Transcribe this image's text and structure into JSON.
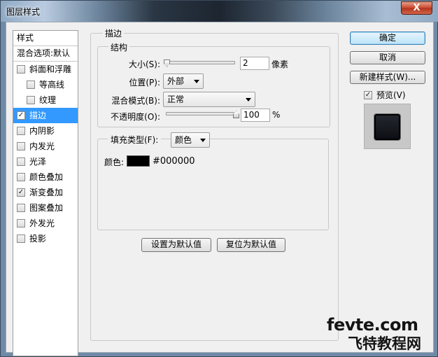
{
  "window": {
    "title": "图层样式",
    "close_label": "X"
  },
  "styles_list": {
    "header": "样式",
    "blending_options": "混合选项:默认",
    "items": [
      {
        "label": "斜面和浮雕",
        "checked": false,
        "indent": false,
        "selected": false
      },
      {
        "label": "等高线",
        "checked": false,
        "indent": true,
        "selected": false
      },
      {
        "label": "纹理",
        "checked": false,
        "indent": true,
        "selected": false
      },
      {
        "label": "描边",
        "checked": true,
        "indent": false,
        "selected": true
      },
      {
        "label": "内阴影",
        "checked": false,
        "indent": false,
        "selected": false
      },
      {
        "label": "内发光",
        "checked": false,
        "indent": false,
        "selected": false
      },
      {
        "label": "光泽",
        "checked": false,
        "indent": false,
        "selected": false
      },
      {
        "label": "颜色叠加",
        "checked": false,
        "indent": false,
        "selected": false
      },
      {
        "label": "渐变叠加",
        "checked": true,
        "indent": false,
        "selected": false
      },
      {
        "label": "图案叠加",
        "checked": false,
        "indent": false,
        "selected": false
      },
      {
        "label": "外发光",
        "checked": false,
        "indent": false,
        "selected": false
      },
      {
        "label": "投影",
        "checked": false,
        "indent": false,
        "selected": false
      }
    ]
  },
  "stroke": {
    "section_title": "描边",
    "structure_title": "结构",
    "size_label": "大小(S):",
    "size_value": "2",
    "size_unit": "像素",
    "size_fraction": 0.0,
    "position_label": "位置(P):",
    "position_value": "外部",
    "blend_label": "混合模式(B):",
    "blend_value": "正常",
    "opacity_label": "不透明度(O):",
    "opacity_value": "100",
    "opacity_unit": "%",
    "opacity_fraction": 1.0,
    "fill_type_label": "填充类型(F):",
    "fill_type_value": "颜色",
    "color_label": "颜色:",
    "color_hex": "#000000",
    "color_swatch": "#000000",
    "set_default_button": "设置为默认值",
    "reset_default_button": "复位为默认值"
  },
  "actions": {
    "ok": "确定",
    "cancel": "取消",
    "new_style": "新建样式(W)...",
    "preview_label": "预览(V)",
    "preview_checked": true
  },
  "watermark": {
    "site": "fevte.com",
    "name": "飞特教程网"
  }
}
